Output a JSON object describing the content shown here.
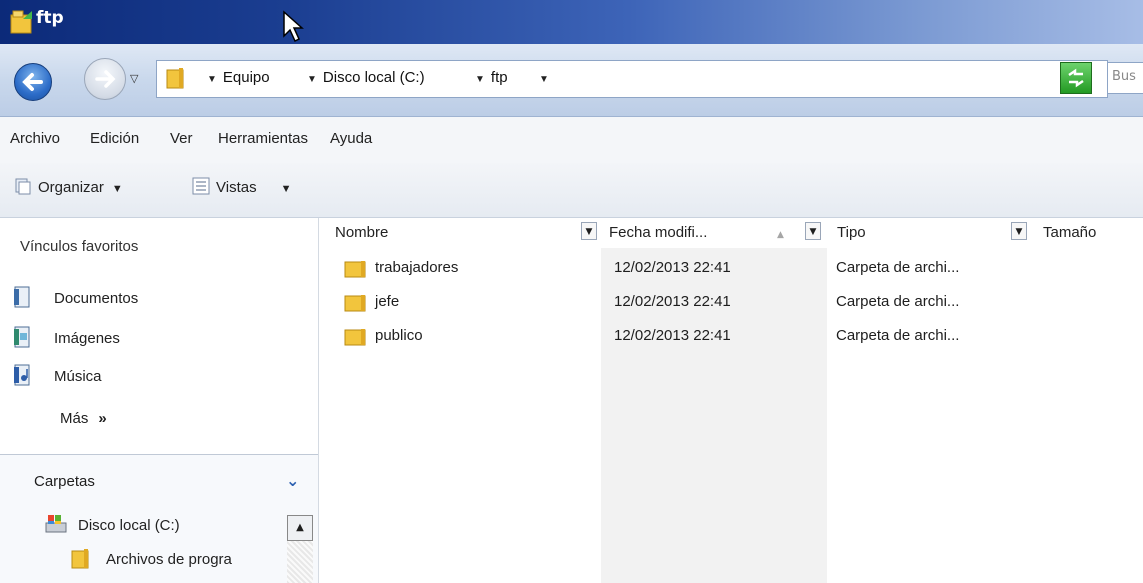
{
  "window": {
    "title": "ftp"
  },
  "address": {
    "crumbs": [
      "Equipo",
      "Disco local (C:)",
      "ftp"
    ],
    "search_placeholder": "Bus"
  },
  "menu": [
    "Archivo",
    "Edición",
    "Ver",
    "Herramientas",
    "Ayuda"
  ],
  "toolbar": {
    "organize": "Organizar",
    "views": "Vistas"
  },
  "nav": {
    "favorites_title": "Vínculos favoritos",
    "favorites": [
      {
        "label": "Documentos",
        "icon": "documents-icon"
      },
      {
        "label": "Imágenes",
        "icon": "pictures-icon"
      },
      {
        "label": "Música",
        "icon": "music-icon"
      }
    ],
    "more_label": "Más",
    "more_chevron": "»",
    "folders_title": "Carpetas",
    "tree": [
      {
        "label": "Disco local (C:)",
        "icon": "local-disk-icon"
      },
      {
        "label": "Archivos de progra",
        "icon": "folder-icon"
      }
    ]
  },
  "columns": [
    "Nombre",
    "Fecha modifi...",
    "Tipo",
    "Tamaño"
  ],
  "files": [
    {
      "name": "trabajadores",
      "date": "12/02/2013 22:41",
      "type": "Carpeta de archi..."
    },
    {
      "name": "jefe",
      "date": "12/02/2013 22:41",
      "type": "Carpeta de archi..."
    },
    {
      "name": "publico",
      "date": "12/02/2013 22:41",
      "type": "Carpeta de archi..."
    }
  ],
  "colors": {
    "title_dark": "#0c2a79",
    "title_light": "#a7bde6",
    "folder": "#f2c53d",
    "sorted_column": "#f2f2f2"
  }
}
